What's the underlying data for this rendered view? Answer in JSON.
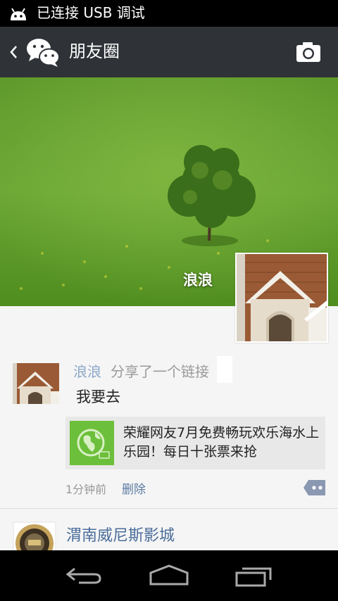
{
  "status_bar": {
    "text": "已连接 USB 调试",
    "icon": "android-icon"
  },
  "title_bar": {
    "title": "朋友圈",
    "icons": [
      "back-icon",
      "wechat-logo-icon",
      "camera-icon"
    ]
  },
  "cover": {
    "owner_name": "浪浪"
  },
  "post": {
    "author": "浪浪",
    "action": "分享了一个链接",
    "message": "我要去",
    "link_text": "荣耀网友7月免费畅玩欢乐海水上乐园！每日十张票来抢",
    "time": "1分钟前",
    "delete_label": "删除"
  },
  "next_post": {
    "author": "渭南威尼斯影城"
  },
  "nav_bar": {
    "icons": [
      "back-nav-icon",
      "home-nav-icon",
      "recents-nav-icon"
    ]
  },
  "colors": {
    "title_bar_bg": "#2f3337",
    "link_blue": "#5c7ba3",
    "card_bg": "#e8e8e8",
    "green": "#6cbf3a"
  }
}
